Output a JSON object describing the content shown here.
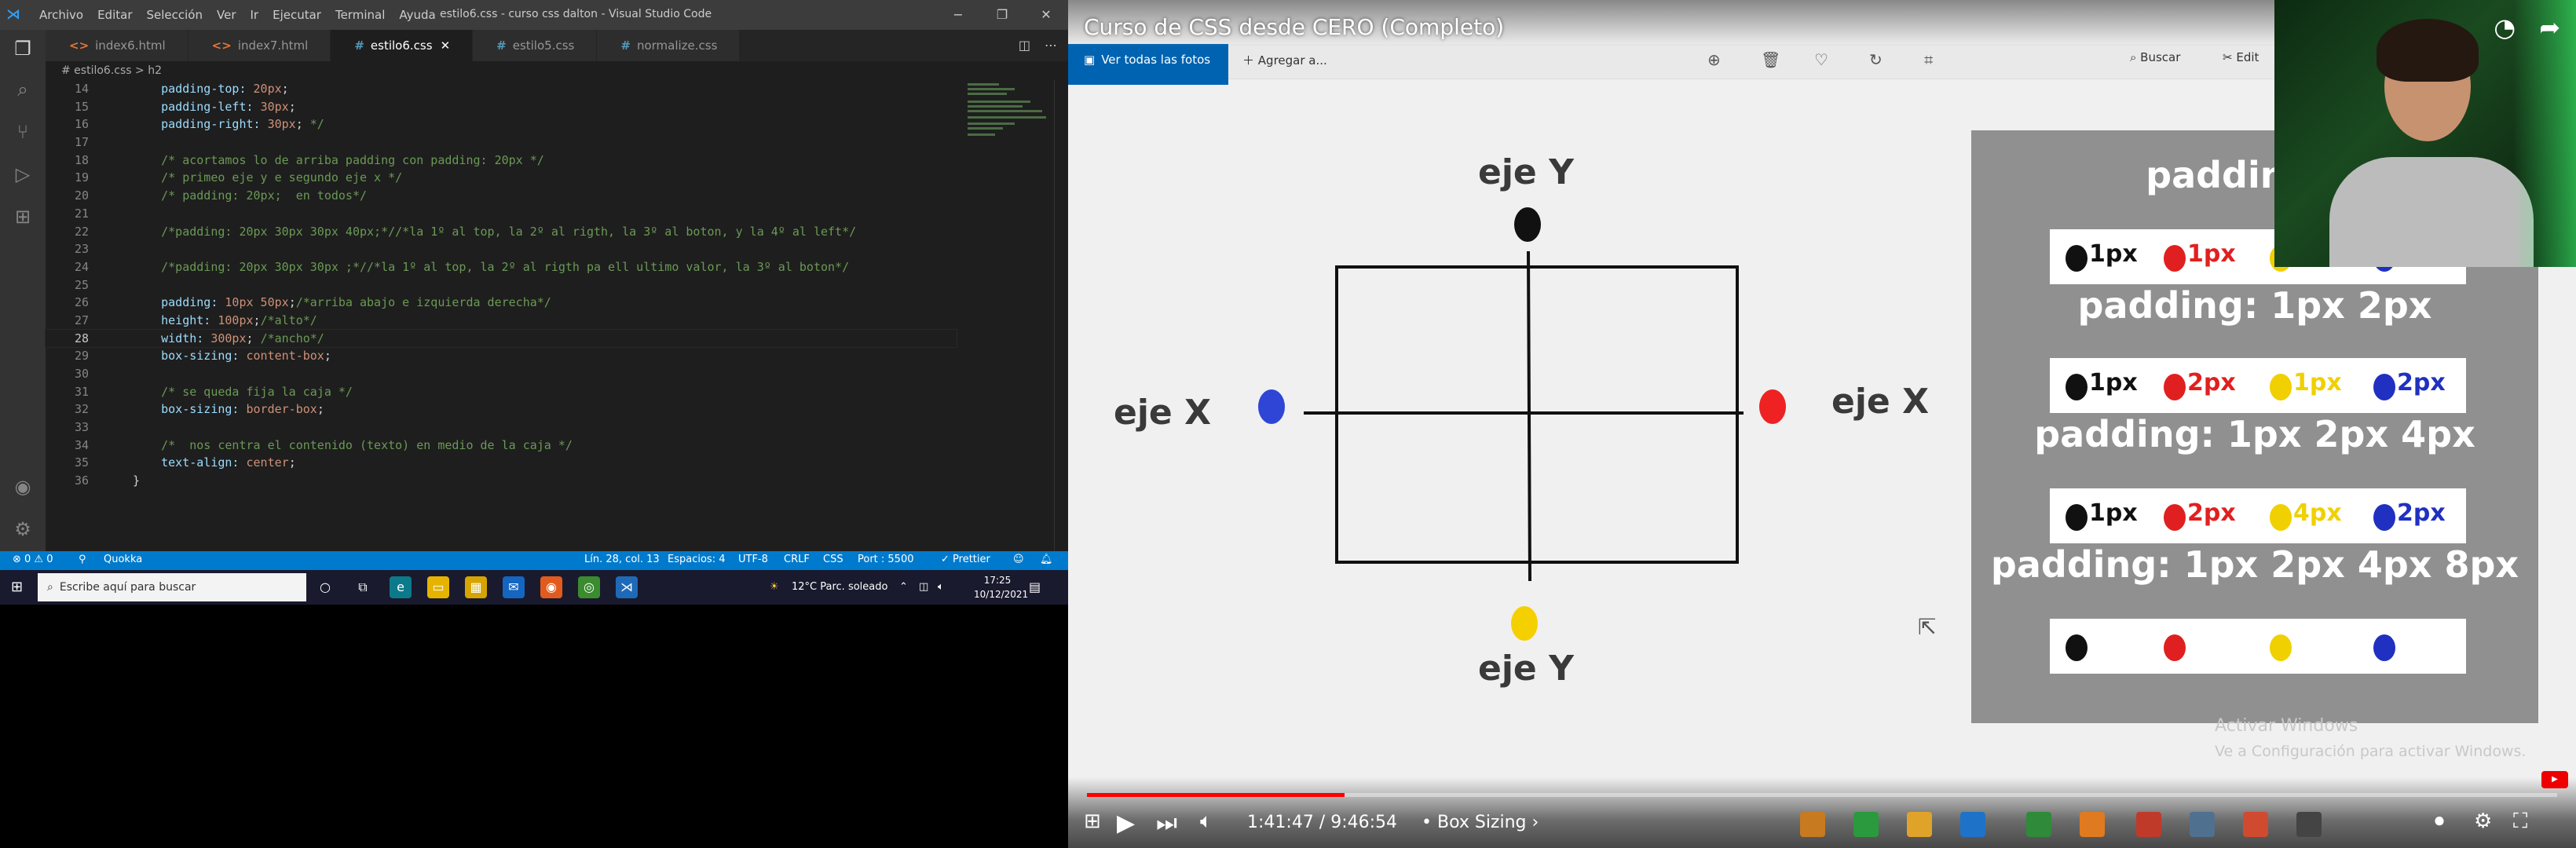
{
  "vscode": {
    "menus": [
      "Archivo",
      "Editar",
      "Selección",
      "Ver",
      "Ir",
      "Ejecutar",
      "Terminal",
      "Ayuda"
    ],
    "window_title": "estilo6.css - curso css dalton - Visual Studio Code",
    "win_controls": [
      "−",
      "❐",
      "✕"
    ],
    "tabs": [
      {
        "icon": "<>",
        "label": "index6.html",
        "active": false
      },
      {
        "icon": "<>",
        "label": "index7.html",
        "active": false
      },
      {
        "icon": "#",
        "label": "estilo6.css",
        "active": true
      },
      {
        "icon": "#",
        "label": "estilo5.css",
        "active": false
      },
      {
        "icon": "#",
        "label": "normalize.css",
        "active": false
      }
    ],
    "tab_close": "✕",
    "breadcrumb": "# estilo6.css  >  h2",
    "code_lines": [
      {
        "n": "14",
        "html": [
          {
            "c": "pr",
            "t": "    padding-top: "
          },
          {
            "c": "vl",
            "t": "20px"
          },
          {
            "c": "pu",
            "t": ";"
          }
        ]
      },
      {
        "n": "15",
        "html": [
          {
            "c": "pr",
            "t": "    padding-left: "
          },
          {
            "c": "vl",
            "t": "30px"
          },
          {
            "c": "pu",
            "t": ";"
          }
        ]
      },
      {
        "n": "16",
        "html": [
          {
            "c": "pr",
            "t": "    padding-right: "
          },
          {
            "c": "vl",
            "t": "30px"
          },
          {
            "c": "pu",
            "t": "; "
          },
          {
            "c": "cm",
            "t": "*/"
          }
        ]
      },
      {
        "n": "17",
        "html": []
      },
      {
        "n": "18",
        "html": [
          {
            "c": "cm",
            "t": "    /* acortamos lo de arriba padding con padding: 20px */"
          }
        ]
      },
      {
        "n": "19",
        "html": [
          {
            "c": "cm",
            "t": "    /* primeo eje y e segundo eje x */"
          }
        ]
      },
      {
        "n": "20",
        "html": [
          {
            "c": "cm",
            "t": "    /* padding: 20px;  en todos*/"
          }
        ]
      },
      {
        "n": "21",
        "html": []
      },
      {
        "n": "22",
        "html": [
          {
            "c": "cm",
            "t": "    /*padding: 20px 30px 30px 40px;*//*la 1º al top, la 2º al rigth, la 3º al boton, y la 4º al left*/"
          }
        ]
      },
      {
        "n": "23",
        "html": []
      },
      {
        "n": "24",
        "html": [
          {
            "c": "cm",
            "t": "    /*padding: 20px 30px 30px ;*//*la 1º al top, la 2º al rigth pa ell ultimo valor, la 3º al boton*/"
          }
        ]
      },
      {
        "n": "25",
        "html": []
      },
      {
        "n": "26",
        "html": [
          {
            "c": "pr",
            "t": "    padding: "
          },
          {
            "c": "vl",
            "t": "10px 50px"
          },
          {
            "c": "pu",
            "t": ";"
          },
          {
            "c": "cm",
            "t": "/*arriba abajo e izquierda derecha*/"
          }
        ]
      },
      {
        "n": "27",
        "html": [
          {
            "c": "pr",
            "t": "    height: "
          },
          {
            "c": "vl",
            "t": "100px"
          },
          {
            "c": "pu",
            "t": ";"
          },
          {
            "c": "cm",
            "t": "/*alto*/"
          }
        ]
      },
      {
        "n": "28",
        "html": [
          {
            "c": "pr",
            "t": "    width: "
          },
          {
            "c": "vl",
            "t": "300px"
          },
          {
            "c": "pu",
            "t": "; "
          },
          {
            "c": "cm",
            "t": "/*ancho*/"
          }
        ]
      },
      {
        "n": "29",
        "html": [
          {
            "c": "pr",
            "t": "    box-sizing: "
          },
          {
            "c": "vl",
            "t": "content-box"
          },
          {
            "c": "pu",
            "t": ";"
          }
        ]
      },
      {
        "n": "30",
        "html": []
      },
      {
        "n": "31",
        "html": [
          {
            "c": "cm",
            "t": "    /* se queda fija la caja */"
          }
        ]
      },
      {
        "n": "32",
        "html": [
          {
            "c": "pr",
            "t": "    box-sizing: "
          },
          {
            "c": "vl",
            "t": "border-box"
          },
          {
            "c": "pu",
            "t": ";"
          }
        ]
      },
      {
        "n": "33",
        "html": []
      },
      {
        "n": "34",
        "html": [
          {
            "c": "cm",
            "t": "    /*  nos centra el contenido (texto) en medio de la caja */"
          }
        ]
      },
      {
        "n": "35",
        "html": [
          {
            "c": "pr",
            "t": "    text-align: "
          },
          {
            "c": "vl",
            "t": "center"
          },
          {
            "c": "pu",
            "t": ";"
          }
        ]
      },
      {
        "n": "36",
        "html": [
          {
            "c": "pu",
            "t": "}"
          }
        ]
      }
    ],
    "current_line": "28",
    "status": {
      "problems": "⊗ 0 ⚠ 0",
      "quokka": "Quokka",
      "position": "Lín. 28, col. 13",
      "spaces": "Espacios: 4",
      "encoding": "UTF-8",
      "eol": "CRLF",
      "language": "CSS",
      "port": "Port : 5500",
      "prettier": "✓ Prettier"
    },
    "accent": "#007acc"
  },
  "taskbar": {
    "search_placeholder": "Escribe aquí para buscar",
    "weather": "12°C  Parc. soleado",
    "time": "17:25",
    "date": "10/12/2021"
  },
  "video": {
    "title": "Curso de CSS desde CERO (Completo)",
    "photos_button": "Ver todas las fotos",
    "add_to": "Agregar a...",
    "search": "Buscar",
    "edit": "Edit",
    "diagram": {
      "eje_y_top": "eje Y",
      "eje_y_bottom": "eje Y",
      "eje_x_left": "eje X",
      "eje_x_right": "eje X"
    },
    "padding_panel": [
      {
        "title": "padding: 1",
        "values": [
          {
            "color": "#111",
            "t": "1px"
          },
          {
            "color": "#e02020",
            "t": "1px"
          },
          {
            "color": "#f0d000",
            "t": ""
          },
          {
            "color": "#2030c0",
            "t": ""
          }
        ]
      },
      {
        "title": "padding: 1px 2px",
        "values": [
          {
            "color": "#111",
            "t": "1px"
          },
          {
            "color": "#e02020",
            "t": "2px"
          },
          {
            "color": "#f0d000",
            "t": "1px"
          },
          {
            "color": "#2030c0",
            "t": "2px"
          }
        ]
      },
      {
        "title": "padding: 1px 2px 4px",
        "values": [
          {
            "color": "#111",
            "t": "1px"
          },
          {
            "color": "#e02020",
            "t": "2px"
          },
          {
            "color": "#f0d000",
            "t": "4px"
          },
          {
            "color": "#2030c0",
            "t": "2px"
          }
        ]
      },
      {
        "title": "padding: 1px 2px 4px 8px",
        "values": [
          {
            "color": "#111",
            "t": ""
          },
          {
            "color": "#e02020",
            "t": ""
          },
          {
            "color": "#f0d000",
            "t": ""
          },
          {
            "color": "#2030c0",
            "t": ""
          }
        ]
      }
    ],
    "activate_windows": "Activar Windows",
    "activate_windows_sub": "Ve a Configuración para activar Windows.",
    "time": "1:41:47 / 9:46:54",
    "chapter": "• Box Sizing ›",
    "progress": 0.175
  }
}
